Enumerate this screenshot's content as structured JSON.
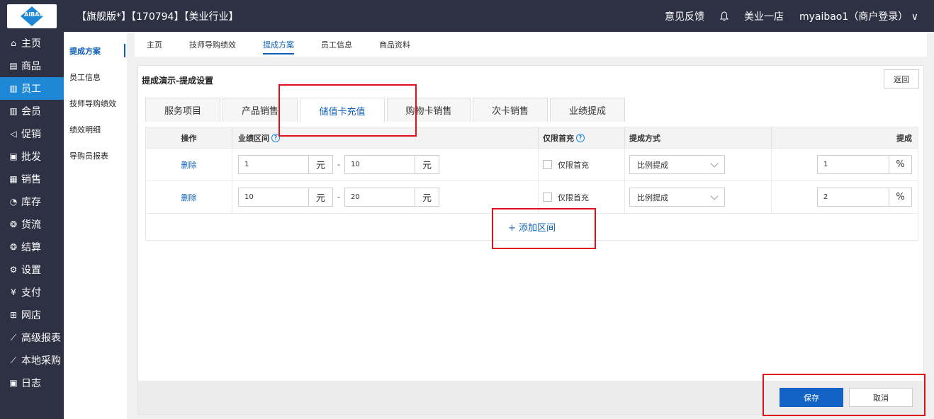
{
  "header": {
    "logo_text": "AIBAO",
    "title": "【旗舰版*】【170794】【美业行业】",
    "feedback": "意见反馈",
    "store": "美业一店",
    "user": "myaibao1（商户登录）"
  },
  "sidebar": {
    "items": [
      {
        "label": "主页",
        "icon": "⌂"
      },
      {
        "label": "商品",
        "icon": "▤"
      },
      {
        "label": "员工",
        "icon": "▥"
      },
      {
        "label": "会员",
        "icon": "▥"
      },
      {
        "label": "促销",
        "icon": "◁"
      },
      {
        "label": "批发",
        "icon": "▣"
      },
      {
        "label": "销售",
        "icon": "▦"
      },
      {
        "label": "库存",
        "icon": "◔"
      },
      {
        "label": "货流",
        "icon": "❂"
      },
      {
        "label": "结算",
        "icon": "❂"
      },
      {
        "label": "设置",
        "icon": "⚙"
      },
      {
        "label": "支付",
        "icon": "¥"
      },
      {
        "label": "网店",
        "icon": "⊞"
      },
      {
        "label": "高级报表",
        "icon": "⟋"
      },
      {
        "label": "本地采购",
        "icon": "⟋"
      },
      {
        "label": "日志",
        "icon": "▣"
      }
    ]
  },
  "subsidebar": {
    "items": [
      "提成方案",
      "员工信息",
      "技师导购绩效",
      "绩效明细",
      "导购员报表"
    ]
  },
  "toptabs": [
    "主页",
    "技师导购绩效",
    "提成方案",
    "员工信息",
    "商品资料"
  ],
  "panel": {
    "title": "提成演示-提成设置",
    "back": "返回"
  },
  "subtabs": [
    "服务项目",
    "产品销售",
    "储值卡充值",
    "购物卡销售",
    "次卡销售",
    "业绩提成"
  ],
  "table": {
    "headers": {
      "op": "操作",
      "range": "业绩区间",
      "first": "仅限首充",
      "method": "提成方式",
      "comm": "提成"
    },
    "rows": [
      {
        "op": "删除",
        "from": "1",
        "to": "10",
        "unit": "元",
        "first": "仅限首充",
        "method": "比例提成",
        "comm": "1",
        "pct": "%"
      },
      {
        "op": "删除",
        "from": "10",
        "to": "20",
        "unit": "元",
        "first": "仅限首充",
        "method": "比例提成",
        "comm": "2",
        "pct": "%"
      }
    ],
    "add": "+ 添加区间",
    "dash": "-",
    "qmark": "?"
  },
  "footer": {
    "save": "保存",
    "cancel": "取消"
  },
  "colors": {
    "sidebar_bg": "#2e3143",
    "active": "#1e88d6",
    "link": "#0e5fb4",
    "save": "#1363c6",
    "highlight": "#e0101a"
  }
}
